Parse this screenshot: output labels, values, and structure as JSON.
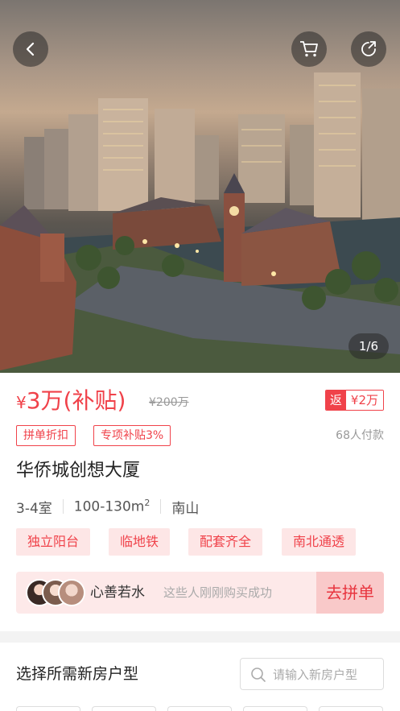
{
  "hero": {
    "counter": "1/6",
    "icons": {
      "back": "chevron-left-icon",
      "cart": "cart-icon",
      "share": "share-icon"
    }
  },
  "price": {
    "currency": "¥",
    "main": "3万(补贴)",
    "old": "¥200万",
    "rebate_tag": "返",
    "rebate_value": "¥2万"
  },
  "promos": [
    "拼单折扣",
    "专项补贴3%"
  ],
  "paid_count": "68人付款",
  "title": "华侨城创想大厦",
  "specs": {
    "rooms": "3-4室",
    "area": "100-130m",
    "area_sup": "2",
    "district": "南山"
  },
  "features": [
    "独立阳台",
    "临地铁",
    "配套齐全",
    "南北通透"
  ],
  "group": {
    "name": "心善若水",
    "hint": "这些人刚刚购买成功",
    "join_label": "去拼单"
  },
  "floorplan": {
    "title": "选择所需新房户型",
    "search_placeholder": "请输入新房户型"
  },
  "colors": {
    "accent": "#f0424a",
    "tag_bg": "#fde6e6",
    "group_bg": "#fde9e9"
  }
}
